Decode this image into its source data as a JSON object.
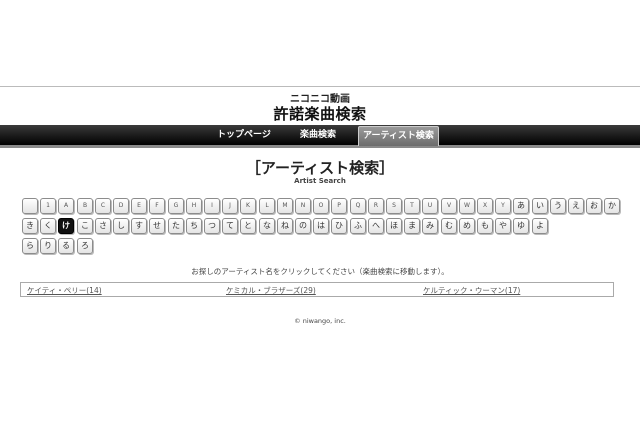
{
  "brand": {
    "sub": "ニコニコ動画",
    "main": "許諾楽曲検索"
  },
  "nav": {
    "items": [
      {
        "label": "トップページ",
        "active": false
      },
      {
        "label": "楽曲検索",
        "active": false
      },
      {
        "label": "アーティスト検索",
        "active": true
      }
    ]
  },
  "page": {
    "title": "［アーティスト検索］",
    "subtitle": "Artist Search"
  },
  "keys": {
    "row1": [
      "",
      "1",
      "A",
      "B",
      "C",
      "D",
      "E",
      "F",
      "G",
      "H",
      "I",
      "J",
      "K",
      "L",
      "M",
      "N",
      "O",
      "P",
      "Q",
      "R",
      "S",
      "T",
      "U",
      "V",
      "W",
      "X",
      "Y",
      "あ",
      "い",
      "う",
      "え",
      "お",
      "か"
    ],
    "row2": [
      "き",
      "く",
      "け",
      "こ",
      "さ",
      "し",
      "す",
      "せ",
      "た",
      "ち",
      "つ",
      "て",
      "と",
      "な",
      "ね",
      "の",
      "は",
      "ひ",
      "ふ",
      "へ",
      "ほ",
      "ま",
      "み",
      "む",
      "め",
      "も",
      "や",
      "ゆ",
      "よ"
    ],
    "row3": [
      "ら",
      "り",
      "る",
      "ろ"
    ],
    "selected": "け"
  },
  "hint": "お探しのアーティスト名をクリックしてください（楽曲検索に移動します）。",
  "results": [
    {
      "label": "ケイティ・ペリー(14)"
    },
    {
      "label": "ケミカル・ブラザーズ(29)"
    },
    {
      "label": "ケルティック・ウーマン(17)"
    }
  ],
  "footer": "© niwango, inc."
}
